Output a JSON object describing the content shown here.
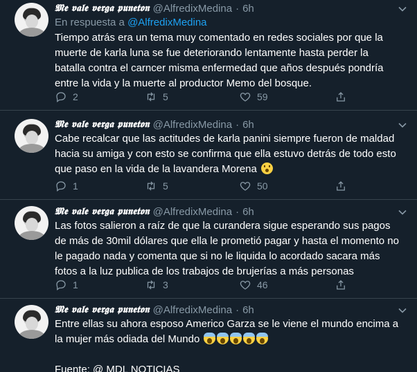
{
  "tweets": [
    {
      "display_name": "𝕸𝖊 𝖛𝖆𝖑𝖊 𝖛𝖊𝖗𝖌𝖆 𝖕𝖚𝖓𝖊𝖙𝖔𝖓",
      "handle": "@AlfredixMedina",
      "dot": "·",
      "time": "6h",
      "reply_prefix": "En respuesta a",
      "reply_mention": "@AlfredixMedina",
      "lines": [
        "Tiempo atrás era un tema muy comentado en redes sociales por que la",
        "muerte de karla luna se fue deteriorando lentamente hasta perder la",
        "batalla contra el carncer misma enfermedad que años después  pondría",
        "entre la vida y la muerte al productor Memo del bosque."
      ],
      "replies": "2",
      "retweets": "5",
      "likes": "59"
    },
    {
      "display_name": "𝕸𝖊 𝖛𝖆𝖑𝖊 𝖛𝖊𝖗𝖌𝖆 𝖕𝖚𝖓𝖊𝖙𝖔𝖓",
      "handle": "@AlfredixMedina",
      "dot": "·",
      "time": "6h",
      "lines": [
        "Cabe recalcar que las actitudes de karla panini siempre fueron de maldad",
        "hacia su amiga y con esto se confirma que ella estuvo detrás de todo esto",
        "que paso en la vida de la lavandera Morena"
      ],
      "emoji": "hushed-face",
      "replies": "1",
      "retweets": "5",
      "likes": "50"
    },
    {
      "display_name": "𝕸𝖊 𝖛𝖆𝖑𝖊 𝖛𝖊𝖗𝖌𝖆 𝖕𝖚𝖓𝖊𝖙𝖔𝖓",
      "handle": "@AlfredixMedina",
      "dot": "·",
      "time": "6h",
      "lines": [
        "Las fotos salieron a raíz de que la curandera sigue esperando sus pagos",
        "de más de 30mil dólares que ella le prometió pagar y hasta el momento no",
        "le pagado nada y comenta que si no le liquida lo acordado sacara más",
        "fotos a la luz publica de los trabajos de brujerías a más personas"
      ],
      "replies": "1",
      "retweets": "3",
      "likes": "46"
    },
    {
      "display_name": "𝕸𝖊 𝖛𝖆𝖑𝖊 𝖛𝖊𝖗𝖌𝖆 𝖕𝖚𝖓𝖊𝖙𝖔𝖓",
      "handle": "@AlfredixMedina",
      "dot": "·",
      "time": "6h",
      "lines": [
        "Entre ellas su ahora esposo Americo Garza se le viene el mundo encima a",
        "la mujer más odiada del Mundo"
      ],
      "emoji_row": "screaming-face x5",
      "source_line": "Fuente: @ MDL NOTICIAS"
    }
  ],
  "colors": {
    "background": "#15202b",
    "divider": "#38444d",
    "secondary_text": "#8899a6",
    "accent": "#1da1f2"
  },
  "icons": {
    "reply": "reply-icon",
    "retweet": "retweet-icon",
    "like": "heart-icon",
    "share": "share-icon",
    "menu": "chevron-down-icon"
  }
}
